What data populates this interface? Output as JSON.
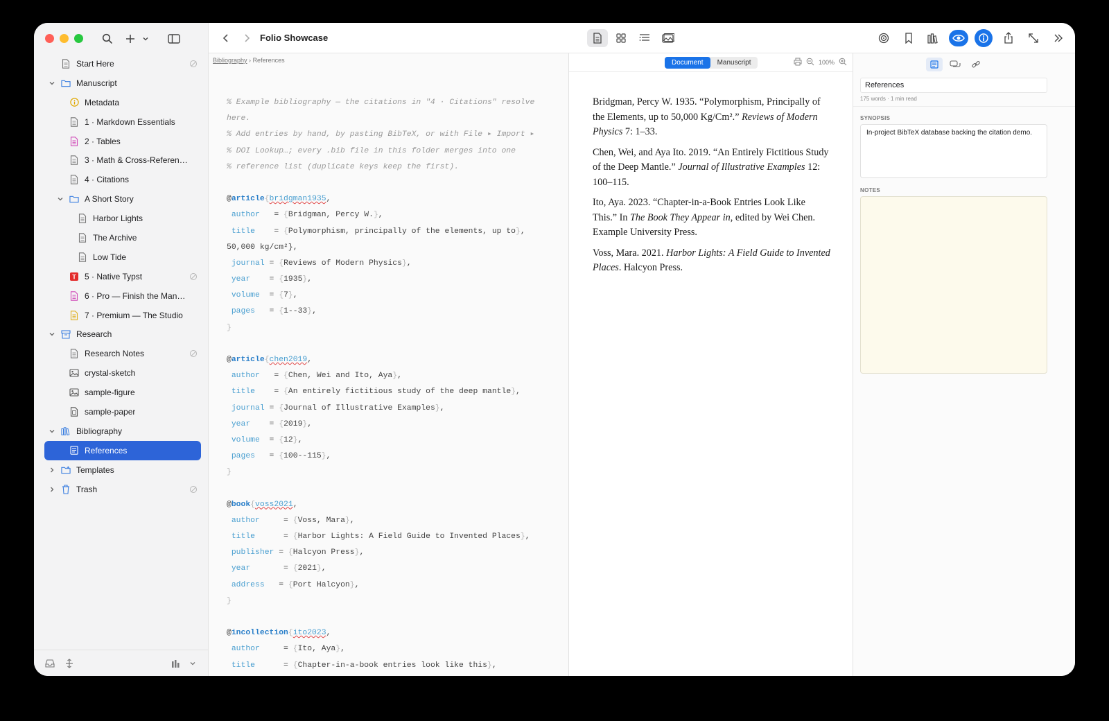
{
  "window": {
    "title": "Folio Showcase"
  },
  "sidebar": {
    "items": [
      {
        "label": "Start Here",
        "icon": "document-icon",
        "depth": 0,
        "chevron": "",
        "badge": true
      },
      {
        "label": "Manuscript",
        "icon": "folder-icon",
        "depth": 0,
        "chevron": "down",
        "badge": false
      },
      {
        "label": "Metadata",
        "icon": "info-icon",
        "depth": 1,
        "chevron": "",
        "badge": false
      },
      {
        "label": "1 · Markdown Essentials",
        "icon": "document-icon",
        "depth": 1,
        "chevron": "",
        "badge": false
      },
      {
        "label": "2 · Tables",
        "icon": "document-pink-icon",
        "depth": 1,
        "chevron": "",
        "badge": false
      },
      {
        "label": "3 · Math & Cross-References",
        "icon": "document-icon",
        "depth": 1,
        "chevron": "",
        "badge": false
      },
      {
        "label": "4 · Citations",
        "icon": "document-icon",
        "depth": 1,
        "chevron": "",
        "badge": false
      },
      {
        "label": "A Short Story",
        "icon": "folder-icon",
        "depth": 1,
        "chevron": "down",
        "badge": false
      },
      {
        "label": "Harbor Lights",
        "icon": "document-icon",
        "depth": 2,
        "chevron": "",
        "badge": false
      },
      {
        "label": "The Archive",
        "icon": "document-icon",
        "depth": 2,
        "chevron": "",
        "badge": false
      },
      {
        "label": "Low Tide",
        "icon": "document-icon",
        "depth": 2,
        "chevron": "",
        "badge": false
      },
      {
        "label": "5 · Native Typst",
        "icon": "typst-icon",
        "depth": 1,
        "chevron": "",
        "badge": true
      },
      {
        "label": "6 · Pro — Finish the Manus...",
        "icon": "document-pink-icon",
        "depth": 1,
        "chevron": "",
        "badge": false
      },
      {
        "label": "7 · Premium — The Studio",
        "icon": "document-yellow-icon",
        "depth": 1,
        "chevron": "",
        "badge": false
      },
      {
        "label": "Research",
        "icon": "archive-box-icon",
        "depth": 0,
        "chevron": "down",
        "badge": false
      },
      {
        "label": "Research Notes",
        "icon": "document-icon",
        "depth": 1,
        "chevron": "",
        "badge": true
      },
      {
        "label": "crystal-sketch",
        "icon": "image-icon",
        "depth": 1,
        "chevron": "",
        "badge": false
      },
      {
        "label": "sample-figure",
        "icon": "image-icon",
        "depth": 1,
        "chevron": "",
        "badge": false
      },
      {
        "label": "sample-paper",
        "icon": "pdf-icon",
        "depth": 1,
        "chevron": "",
        "badge": false
      },
      {
        "label": "Bibliography",
        "icon": "books-icon",
        "depth": 0,
        "chevron": "down",
        "badge": false
      },
      {
        "label": "References",
        "icon": "bibliography-icon",
        "depth": 1,
        "chevron": "",
        "badge": false,
        "selected": true
      },
      {
        "label": "Templates",
        "icon": "folder-plus-icon",
        "depth": 0,
        "chevron": "right",
        "badge": false
      },
      {
        "label": "Trash",
        "icon": "trash-icon",
        "depth": 0,
        "chevron": "right",
        "badge": true
      }
    ]
  },
  "editor": {
    "breadcrumb": {
      "parent": "Bibliography",
      "separator": "›",
      "current": "References"
    },
    "lines": [
      {
        "t": "cmt",
        "text": "% Example bibliography — the citations in \"4 · Citations\" resolve"
      },
      {
        "t": "cmt",
        "text": "here."
      },
      {
        "t": "cmt",
        "text": "% Add entries by hand, by pasting BibTeX, or with File ▸ Import ▸"
      },
      {
        "t": "cmt",
        "text": "% DOI Lookup…; every .bib file in this folder merges into one"
      },
      {
        "t": "cmt",
        "text": "% reference list (duplicate keys keep the first)."
      },
      {
        "t": "blank",
        "text": ""
      },
      {
        "t": "entry",
        "type": "article",
        "key": "bridgman1935"
      },
      {
        "t": "field",
        "name": "author",
        "pad": "  ",
        "value": "Bridgman, Percy W."
      },
      {
        "t": "field",
        "name": "title",
        "pad": "   ",
        "value": "Polymorphism, principally of the elements, up to"
      },
      {
        "t": "cont",
        "text": "50,000 kg/cm²},"
      },
      {
        "t": "field",
        "name": "journal",
        "pad": "",
        "value": "Reviews of Modern Physics"
      },
      {
        "t": "field",
        "name": "year",
        "pad": "   ",
        "value": "1935"
      },
      {
        "t": "field",
        "name": "volume",
        "pad": " ",
        "value": "7"
      },
      {
        "t": "field",
        "name": "pages",
        "pad": "  ",
        "value": "1--33"
      },
      {
        "t": "close",
        "text": "}"
      },
      {
        "t": "blank",
        "text": ""
      },
      {
        "t": "entry",
        "type": "article",
        "key": "chen2019"
      },
      {
        "t": "field",
        "name": "author",
        "pad": "  ",
        "value": "Chen, Wei and Ito, Aya"
      },
      {
        "t": "field",
        "name": "title",
        "pad": "   ",
        "value": "An entirely fictitious study of the deep mantle"
      },
      {
        "t": "field",
        "name": "journal",
        "pad": "",
        "value": "Journal of Illustrative Examples"
      },
      {
        "t": "field",
        "name": "year",
        "pad": "   ",
        "value": "2019"
      },
      {
        "t": "field",
        "name": "volume",
        "pad": " ",
        "value": "12"
      },
      {
        "t": "field",
        "name": "pages",
        "pad": "  ",
        "value": "100--115"
      },
      {
        "t": "close",
        "text": "}"
      },
      {
        "t": "blank",
        "text": ""
      },
      {
        "t": "entry",
        "type": "book",
        "key": "voss2021"
      },
      {
        "t": "field",
        "name": "author",
        "pad": "    ",
        "value": "Voss, Mara"
      },
      {
        "t": "field",
        "name": "title",
        "pad": "     ",
        "value": "Harbor Lights: A Field Guide to Invented Places"
      },
      {
        "t": "field",
        "name": "publisher",
        "pad": "",
        "value": "Halcyon Press"
      },
      {
        "t": "field",
        "name": "year",
        "pad": "      ",
        "value": "2021"
      },
      {
        "t": "field",
        "name": "address",
        "pad": "  ",
        "value": "Port Halcyon"
      },
      {
        "t": "close",
        "text": "}"
      },
      {
        "t": "blank",
        "text": ""
      },
      {
        "t": "entry",
        "type": "incollection",
        "key": "ito2023"
      },
      {
        "t": "field",
        "name": "author",
        "pad": "    ",
        "value": "Ito, Aya"
      },
      {
        "t": "field",
        "name": "title",
        "pad": "     ",
        "value": "Chapter-in-a-book entries look like this"
      }
    ]
  },
  "preview": {
    "tabs": [
      "Document",
      "Manuscript"
    ],
    "active_tab": 0,
    "zoom": "100%",
    "references": [
      {
        "plain": "Bridgman, Percy W. 1935. “Polymorphism, Principally of the Elements, up to 50,000 Kg/Cm².” ",
        "italic": "Reviews of Modern Physics",
        "tail": " 7: 1–33."
      },
      {
        "plain": "Chen, Wei, and Aya Ito. 2019. “An Entirely Fictitious Study of the Deep Mantle.” ",
        "italic": "Journal of Illustrative Examples",
        "tail": " 12: 100–115."
      },
      {
        "plain": "Ito, Aya. 2023. “Chapter-in-a-Book Entries Look Like This.” In ",
        "italic": "The Book They Appear in",
        "tail": ", edited by Wei Chen. Example University Press."
      },
      {
        "plain": "Voss, Mara. 2021. ",
        "italic": "Harbor Lights: A Field Guide to Invented Places",
        "tail": ". Halcyon Press."
      }
    ]
  },
  "inspector": {
    "title": "References",
    "meta": "175 words · 1 min read",
    "synopsis_label": "SYNOPSIS",
    "synopsis": "In-project BibTeX database backing the citation demo.",
    "notes_label": "NOTES",
    "notes": ""
  },
  "colors": {
    "accent": "#1a73e8",
    "selection": "#2d64d8",
    "notes_bg": "#fdfaec"
  }
}
